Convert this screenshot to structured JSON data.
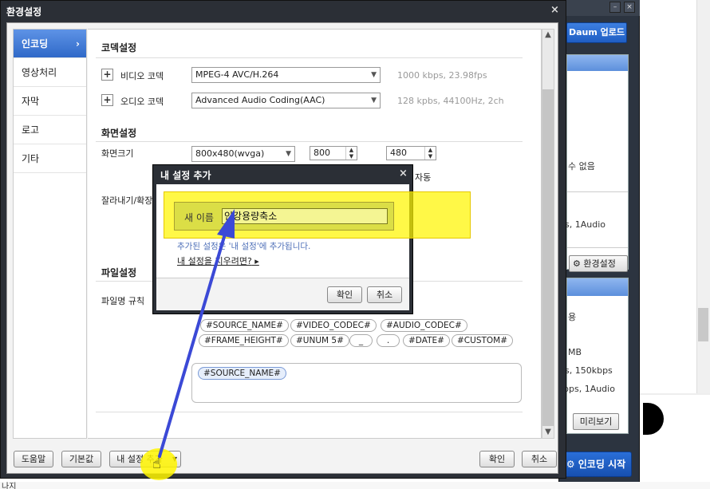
{
  "background_app": {
    "daum_upload": "Daum 업로드",
    "lines": [
      "수 없음",
      "s, 1Audio",
      "용",
      "MB",
      "s, 150kbps",
      "bps, 1Audio"
    ],
    "env_settings_label": "환경설정",
    "preview_label": "미리보기",
    "encode_start_label": "인코딩 시작",
    "window_btn_minimize": "–",
    "window_btn_close": "×",
    "bottom_text": "나지"
  },
  "dialog": {
    "title": "환경설정",
    "close_glyph": "×",
    "sidebar": [
      {
        "label": "인코딩",
        "active": true
      },
      {
        "label": "영상처리",
        "active": false
      },
      {
        "label": "자막",
        "active": false
      },
      {
        "label": "로고",
        "active": false
      },
      {
        "label": "기타",
        "active": false
      }
    ],
    "sidebar_arrow": "›",
    "codec": {
      "title": "코덱설정",
      "video_label": "비디오 코덱",
      "video_value": "MPEG-4 AVC/H.264",
      "video_info": "1000 kbps, 23.98fps",
      "audio_label": "오디오 코덱",
      "audio_value": "Advanced Audio Coding(AAC)",
      "audio_info": "128 kpbs, 44100Hz, 2ch"
    },
    "screen": {
      "title": "화면설정",
      "size_label": "화면크기",
      "size_value": "800x480(wvga)",
      "width_value": "800",
      "height_value": "480",
      "auto_label": "자동",
      "crop_label": "잘라내기/확장"
    },
    "file": {
      "title": "파일설정",
      "rule_label": "파일명 규칙",
      "tags_row1": [
        "#SOURCE_NAME#",
        "#VIDEO_CODEC#",
        "#AUDIO_CODEC#"
      ],
      "tags_row2": [
        "#FRAME_HEIGHT#",
        "#UNUM 5#",
        "_",
        ".",
        "#DATE#",
        "#CUSTOM#"
      ],
      "selected_tag": "#SOURCE_NAME#"
    },
    "buttons": {
      "help": "도움말",
      "default": "기본값",
      "my_settings_add": "내 설정 추가",
      "ok": "확인",
      "cancel": "취소"
    }
  },
  "subdialog": {
    "title": "내 설정 추가",
    "close_glyph": "×",
    "name_label": "새 이름",
    "name_value": "인강용량축소",
    "note": "추가된 설정은 '내 설정'에 추가됩니다.",
    "link": "내 설정을 지우려면?",
    "ok": "확인",
    "cancel": "취소"
  },
  "colors": {
    "accent_blue": "#2f69c8",
    "highlight_yellow": "#fff500",
    "annotation_arrow": "#3b49d6",
    "dark_frame": "#2b2f36"
  }
}
